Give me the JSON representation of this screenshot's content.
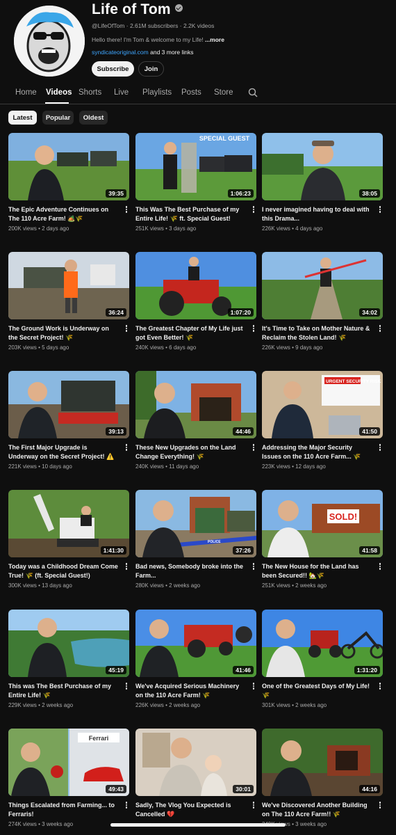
{
  "channel": {
    "name": "Life of Tom",
    "handle": "@LifeOfTom",
    "subscribers": "2.61M subscribers",
    "video_count": "2.2K videos",
    "description": "Hello there! I'm Tom & welcome to my Life!",
    "more_label": "...more",
    "link": "syndicateoriginal.com",
    "more_links": "and 3 more links",
    "subscribe_label": "Subscribe",
    "join_label": "Join"
  },
  "tabs": [
    "Home",
    "Videos",
    "Shorts",
    "Live",
    "Playlists",
    "Posts",
    "Store"
  ],
  "active_tab": "Videos",
  "filters": [
    "Latest",
    "Popular",
    "Oldest"
  ],
  "active_filter": "Latest",
  "thumbnail_overlay_text": {
    "special_guest": "SPECIAL GUEST",
    "security_headline": "URGENT SECURITY RISK",
    "sold": "SOLD!",
    "police_tape": "POLICE",
    "sign": "Ferrari"
  },
  "videos": [
    {
      "title": "The Epic Adventure Continues on The 110 Acre Farm! 🏕️🌾",
      "views": "200K views",
      "age": "2 days ago",
      "duration": "39:35"
    },
    {
      "title": "This Was The Best Purchase of my Entire Life! 🌾 ft. Special Guest!",
      "views": "251K views",
      "age": "3 days ago",
      "duration": "1:06:23"
    },
    {
      "title": "I never imagined having to deal with this Drama...",
      "views": "226K views",
      "age": "4 days ago",
      "duration": "38:05"
    },
    {
      "title": "The Ground Work is Underway on the Secret Project! 🌾",
      "views": "203K views",
      "age": "5 days ago",
      "duration": "36:24"
    },
    {
      "title": "The Greatest Chapter of My Life just got Even Better! 🌾",
      "views": "240K views",
      "age": "6 days ago",
      "duration": "1:07:20"
    },
    {
      "title": "It's Time to Take on Mother Nature & Reclaim the Stolen Land! 🌾",
      "views": "226K views",
      "age": "9 days ago",
      "duration": "34:02"
    },
    {
      "title": "The First Major Upgrade is Underway on the Secret Project! ⚠️🌾",
      "views": "221K views",
      "age": "10 days ago",
      "duration": "39:13"
    },
    {
      "title": "These New Upgrades on the Land Change Everything! 🌾",
      "views": "240K views",
      "age": "11 days ago",
      "duration": "44:46"
    },
    {
      "title": "Addressing the Major Security Issues on the 110 Acre Farm... 🌾",
      "views": "223K views",
      "age": "12 days ago",
      "duration": "41:50"
    },
    {
      "title": "Today was a Childhood Dream Come True! 🌾 (ft. Special Guest!)",
      "views": "300K views",
      "age": "13 days ago",
      "duration": "1:41:30"
    },
    {
      "title": "Bad news, Somebody broke into the Farm...",
      "views": "280K views",
      "age": "2 weeks ago",
      "duration": "37:26"
    },
    {
      "title": "The New House for the Land has been Secured!! 🏡🌾",
      "views": "251K views",
      "age": "2 weeks ago",
      "duration": "41:58"
    },
    {
      "title": "This was The Best Purchase of my Entire Life! 🌾",
      "views": "229K views",
      "age": "2 weeks ago",
      "duration": "45:19"
    },
    {
      "title": "We've Acquired Serious Machinery on the 110 Acre Farm! 🌾",
      "views": "226K views",
      "age": "2 weeks ago",
      "duration": "41:46"
    },
    {
      "title": "One of the Greatest Days of My Life! 🌾",
      "views": "301K views",
      "age": "2 weeks ago",
      "duration": "1:31:20"
    },
    {
      "title": "Things Escalated from Farming... to Ferraris!",
      "views": "274K views",
      "age": "3 weeks ago",
      "duration": "49:43"
    },
    {
      "title": "Sadly, The Vlog You Expected is Cancelled 💔",
      "views": "",
      "age": "",
      "duration": "30:01"
    },
    {
      "title": "We've Discovered Another Building on The 110 Acre Farm!! 🌾",
      "views": "349K views",
      "age": "3 weeks ago",
      "duration": "44:16"
    }
  ],
  "colors": {
    "background": "#0f0f0f",
    "text_primary": "#f1f1f1",
    "text_secondary": "#aaaaaa",
    "link": "#3ea6ff",
    "chip": "#272727"
  }
}
